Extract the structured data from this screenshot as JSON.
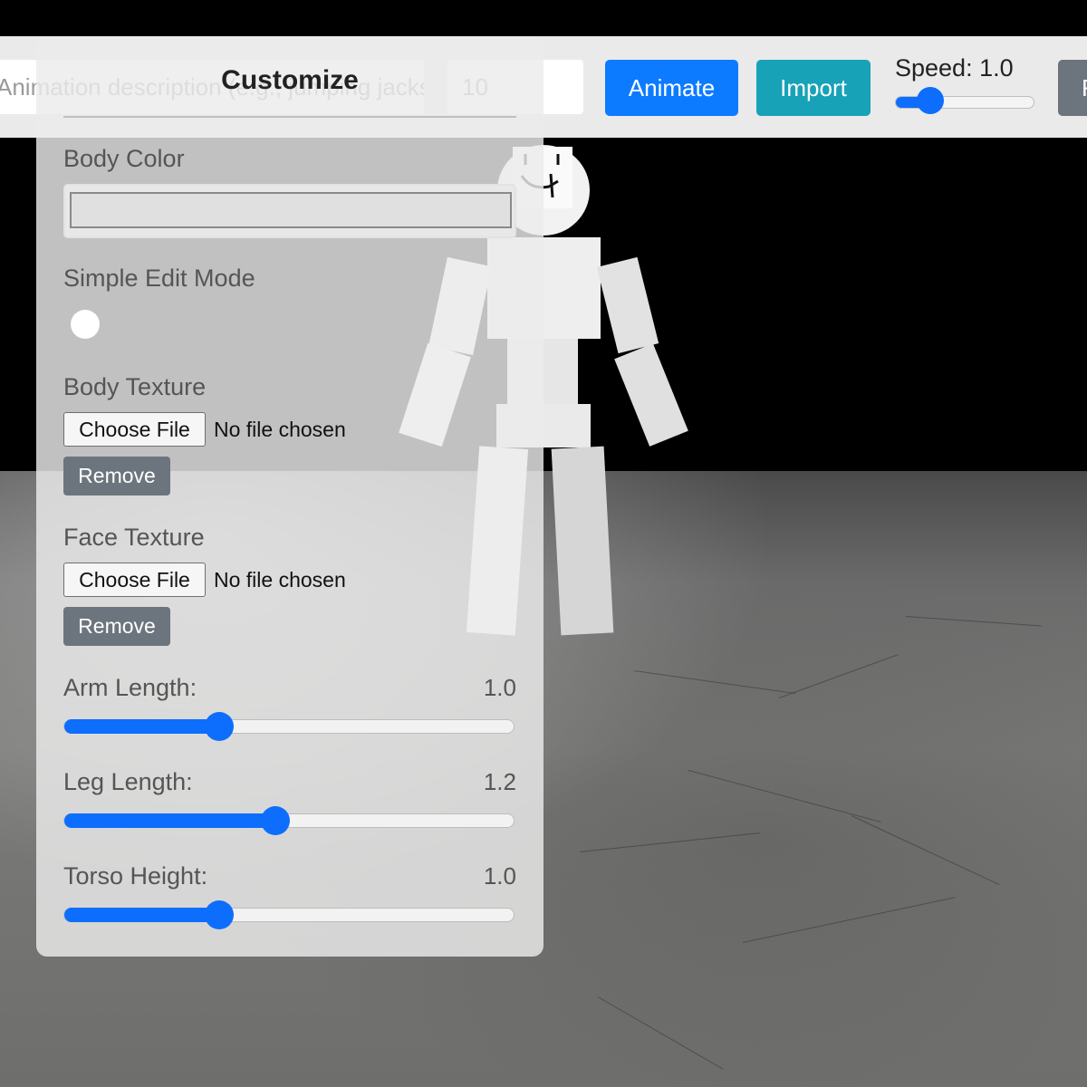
{
  "toolbar": {
    "description_placeholder": "Animation description (e.g., jumping jacks)",
    "frames_placeholder": "10",
    "animate_label": "Animate",
    "import_label": "Import",
    "speed_label": "Speed: 1.0",
    "speed_fraction": 0.25,
    "extra_label": "R"
  },
  "panel": {
    "title": "Customize",
    "body_color_label": "Body Color",
    "simple_edit_label": "Simple Edit Mode",
    "body_texture_label": "Body Texture",
    "body_texture_button": "Choose File",
    "body_texture_status": "No file chosen",
    "body_texture_remove": "Remove",
    "face_texture_label": "Face Texture",
    "face_texture_button": "Choose File",
    "face_texture_status": "No file chosen",
    "face_texture_remove": "Remove",
    "sliders": [
      {
        "label": "Arm Length:",
        "value": "1.0",
        "fraction": 0.345
      },
      {
        "label": "Leg Length:",
        "value": "1.2",
        "fraction": 0.47
      },
      {
        "label": "Torso Height:",
        "value": "1.0",
        "fraction": 0.345
      }
    ]
  },
  "colors": {
    "primary": "#0d6efd",
    "info": "#17a2b8",
    "secondary": "#6c757d"
  }
}
